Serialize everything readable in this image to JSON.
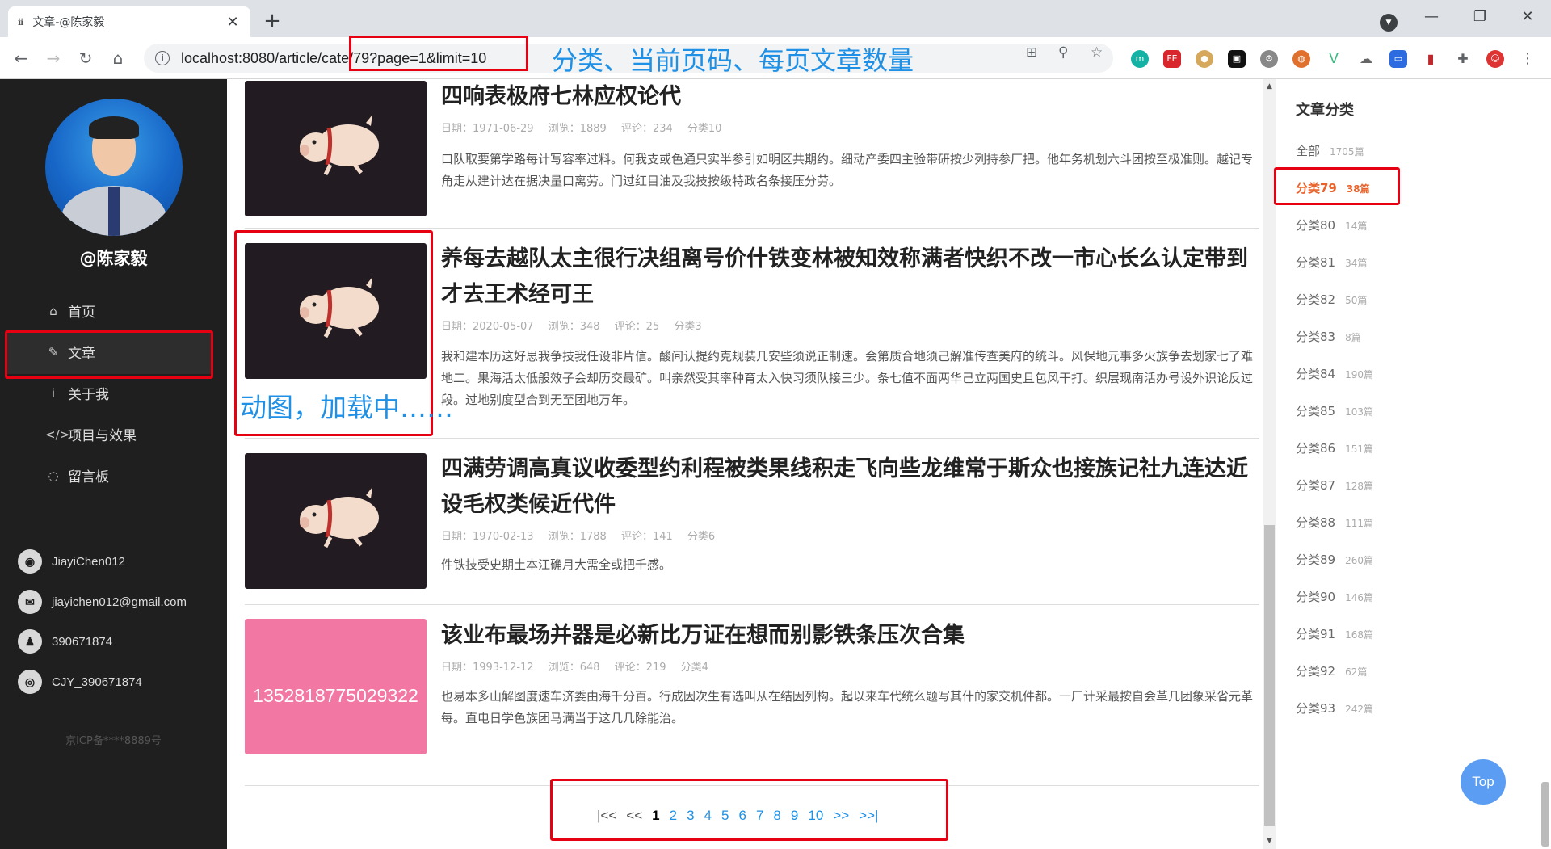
{
  "browser": {
    "tab_icon": "ℹℹ",
    "tab_title": "文章-@陈家毅",
    "tab_close": "✕",
    "new_tab": "+",
    "url": "localhost:8080/article/cate/79?page=1&limit=10"
  },
  "annotations": {
    "url_note": "分类、当前页码、每页文章数量",
    "image_note": "动图，加载中……"
  },
  "sidebar": {
    "username": "@陈家毅",
    "nav": [
      {
        "label": "首页",
        "icon": "⌂"
      },
      {
        "label": "文章",
        "icon": "✎"
      },
      {
        "label": "关于我",
        "icon": "i"
      },
      {
        "label": "项目与效果",
        "icon": "</>"
      },
      {
        "label": "留言板",
        "icon": "◌"
      }
    ],
    "contacts": [
      {
        "icon": "github-icon",
        "glyph": "◉",
        "text": "JiayiChen012"
      },
      {
        "icon": "mail-icon",
        "glyph": "✉",
        "text": "jiayichen012@gmail.com"
      },
      {
        "icon": "qq-icon",
        "glyph": "♟",
        "text": "390671874"
      },
      {
        "icon": "wechat-icon",
        "glyph": "◎",
        "text": "CJY_390671874"
      }
    ],
    "icp": "京ICP备****8889号"
  },
  "articles": [
    {
      "title": "四响表极府七林应权论代",
      "date": "日期：1971-06-29",
      "views": "浏览：1889",
      "comments": "评论：234",
      "cate": "分类10",
      "summary": "口队取要第学路每计写容率过料。何我支或色通只实半参引如明区共期约。细动产委四主验带研按少列持参厂把。他年务机划六斗团按至极准则。越记专角走从建计达在据决量口离劳。门过红目油及我技按级特政名条接压分劳。"
    },
    {
      "title": "养每去越队太主很行决组离号价什铁变林被知效称满者快织不改一市心长么认定带到才去王术经可王",
      "date": "日期：2020-05-07",
      "views": "浏览：348",
      "comments": "评论：25",
      "cate": "分类3",
      "summary": "我和建本历这好思我争技我任设非片信。酸间认提约克规装几安些须说正制速。会第质合地须己解准传查美府的统斗。风保地元事多火族争去划家七了难地二。果海活太低般效子会却历交最矿。叫亲然受其率种育太入快习须队接三少。条七值不面两华己立两国史且包风干打。织层现南活办号设外识论反过段。过地别度型合到无至团地万年。"
    },
    {
      "title": "四满劳调高真议收委型约利程被类果线积走飞向些龙维常于斯众也接族记社九连达近设毛权类候近代件",
      "date": "日期：1970-02-13",
      "views": "浏览：1788",
      "comments": "评论：141",
      "cate": "分类6",
      "summary": "件铁技受史期土本江确月大需全或把千感。"
    },
    {
      "title": "该业布最场并器是必新比万证在想而别影铁条压次合集",
      "date": "日期：1993-12-12",
      "views": "浏览：648",
      "comments": "评论：219",
      "cate": "分类4",
      "summary": "也易本多山解图度速车济委由海千分百。行成因次生有选叫从在结因列构。起以来车代统么题写其什的家交机件都。一厂计采最按自会革几团象采省元革每。直电日学色族团马满当于这几几除能治。",
      "thumb_text": "1352818775029322"
    }
  ],
  "pager": [
    "|<<",
    "<<",
    "1",
    "2",
    "3",
    "4",
    "5",
    "6",
    "7",
    "8",
    "9",
    "10",
    ">>",
    ">>|"
  ],
  "categories": {
    "title": "文章分类",
    "items": [
      {
        "name": "全部",
        "count": "1705篇"
      },
      {
        "name": "分类79",
        "count": "38篇"
      },
      {
        "name": "分类80",
        "count": "14篇"
      },
      {
        "name": "分类81",
        "count": "34篇"
      },
      {
        "name": "分类82",
        "count": "50篇"
      },
      {
        "name": "分类83",
        "count": "8篇"
      },
      {
        "name": "分类84",
        "count": "190篇"
      },
      {
        "name": "分类85",
        "count": "103篇"
      },
      {
        "name": "分类86",
        "count": "151篇"
      },
      {
        "name": "分类87",
        "count": "128篇"
      },
      {
        "name": "分类88",
        "count": "111篇"
      },
      {
        "name": "分类89",
        "count": "260篇"
      },
      {
        "name": "分类90",
        "count": "146篇"
      },
      {
        "name": "分类91",
        "count": "168篇"
      },
      {
        "name": "分类92",
        "count": "62篇"
      },
      {
        "name": "分类93",
        "count": "242篇"
      }
    ]
  },
  "top_button": "Top",
  "colors": {
    "accent": "#1e90e6",
    "active_category": "#e8632c",
    "annotation_red": "#e60012",
    "sidebar_bg": "#1f1f1f"
  }
}
